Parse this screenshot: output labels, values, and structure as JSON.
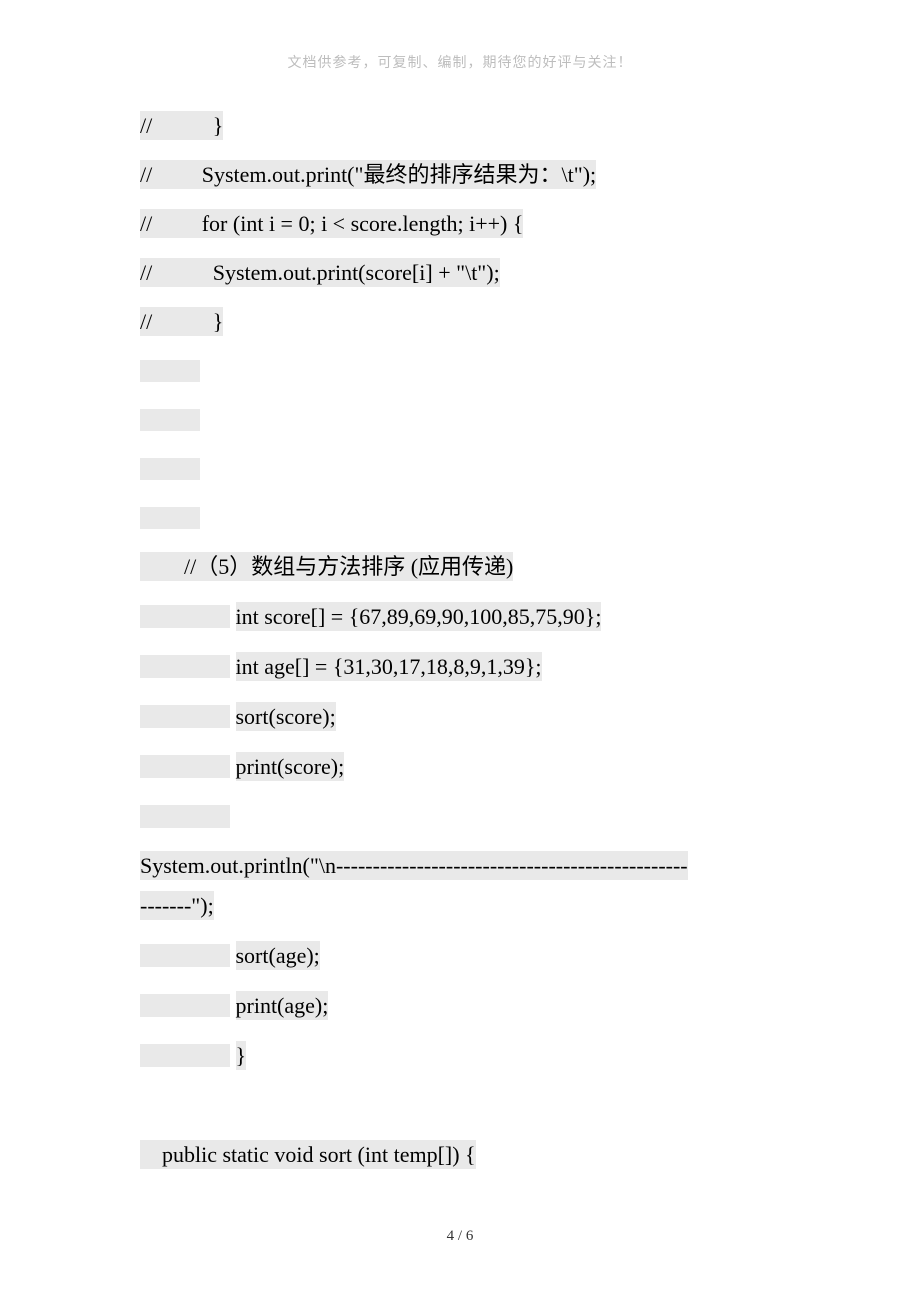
{
  "header": "文档供参考，可复制、编制，期待您的好评与关注！",
  "lines": {
    "l1a": "//",
    "l1b": "}",
    "l2a": "//",
    "l2b": "System.out.print(\"最终的排序结果为：\\t\");",
    "l3a": "//",
    "l3b": "for (int i = 0; i < score.length; i++) {",
    "l4a": "//",
    "l4b": "System.out.print(score[i] + \"\\t\");",
    "l5a": "//",
    "l5b": "}",
    "l6": "//（5）数组与方法排序  (应用传递)",
    "l7": "int score[] = {67,89,69,90,100,85,75,90};",
    "l8": "int age[] = {31,30,17,18,8,9,1,39};",
    "l9": "sort(score);",
    "l10": "print(score);",
    "l11a": "System.out.println(\"\\n------------------------------------------------",
    "l11b": "-------\");",
    "l12": "sort(age);",
    "l13": "print(age);",
    "l14": "}",
    "l15": "public static void sort (int temp[]) {"
  },
  "page_num": "4 / 6"
}
